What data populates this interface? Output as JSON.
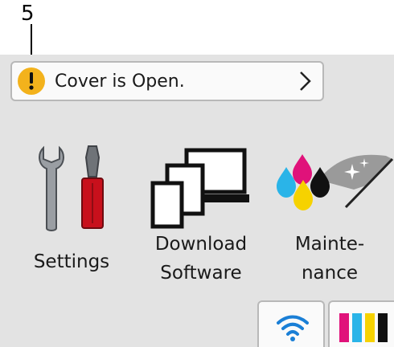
{
  "callout": {
    "number": "5"
  },
  "status": {
    "message": "Cover is Open.",
    "icon": "warning-icon",
    "icon_color": "#f3b21c"
  },
  "tiles": {
    "settings": {
      "label": "Settings",
      "icon": "wrench-screwdriver-icon"
    },
    "download": {
      "label_line1": "Download",
      "label_line2": "Software",
      "icon": "devices-icon"
    },
    "maintenance": {
      "label_line1": "Mainte-",
      "label_line2": "nance",
      "icon": "ink-drops-icon"
    }
  },
  "tray": {
    "wifi": {
      "icon": "wifi-icon",
      "color": "#1a7fd6"
    },
    "ink": {
      "icon": "ink-levels-icon",
      "colors": [
        "#111111",
        "#e0127a",
        "#2ab4e8",
        "#f6d200"
      ]
    }
  }
}
